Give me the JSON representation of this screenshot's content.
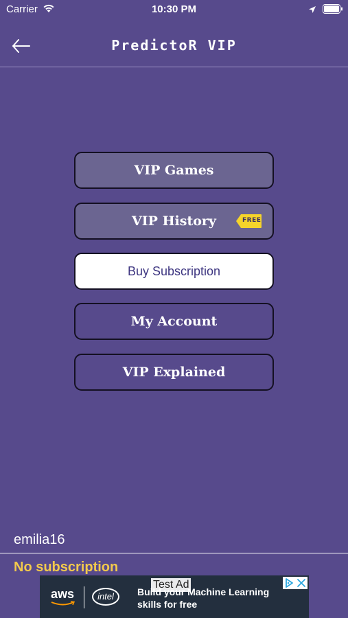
{
  "status_bar": {
    "carrier": "Carrier",
    "time": "10:30 PM"
  },
  "nav": {
    "title": "PredictoR VIP"
  },
  "menu": {
    "vip_games": "VIP Games",
    "vip_history": "VIP History",
    "free_tag": "FREE",
    "buy_subscription": "Buy Subscription",
    "my_account": "My Account",
    "vip_explained": "VIP Explained"
  },
  "account": {
    "username": "emilia16",
    "subscription_status": "No subscription"
  },
  "ad": {
    "label": "Test Ad",
    "brand": "aws",
    "partner": "intel",
    "text": "Build your Machine Learning skills for free"
  },
  "colors": {
    "background": "#574a8c",
    "button_grey": "#6b6591",
    "accent_yellow": "#f2c94c",
    "free_tag": "#f5d42a"
  }
}
